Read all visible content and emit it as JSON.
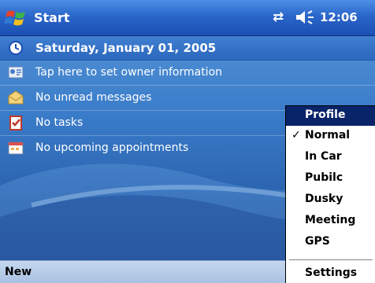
{
  "titlebar": {
    "title": "Start",
    "time": "12:06",
    "icons": [
      "windows-flag-icon",
      "connectivity-icon",
      "volume-icon"
    ]
  },
  "today": {
    "date": "Saturday, January 01, 2005",
    "items": [
      {
        "icon": "owner-info-icon",
        "label": "Tap here to set owner information"
      },
      {
        "icon": "mail-icon",
        "label": "No unread messages"
      },
      {
        "icon": "tasks-icon",
        "label": "No tasks"
      },
      {
        "icon": "calendar-icon",
        "label": "No upcoming appointments"
      }
    ]
  },
  "menubar": {
    "new_label": "New"
  },
  "profile_menu": {
    "header": "Profile",
    "items": [
      {
        "label": "Normal",
        "checked": true
      },
      {
        "label": "In Car",
        "checked": false
      },
      {
        "label": "Pubilc",
        "checked": false
      },
      {
        "label": "Dusky",
        "checked": false
      },
      {
        "label": "Meeting",
        "checked": false
      },
      {
        "label": "GPS",
        "checked": false
      }
    ],
    "footer": "Settings",
    "check_glyph": "✓"
  },
  "colors": {
    "titlebar": "#2a66c9",
    "menu_highlight": "#0a246a",
    "today_bg": "#3a7cc9"
  }
}
